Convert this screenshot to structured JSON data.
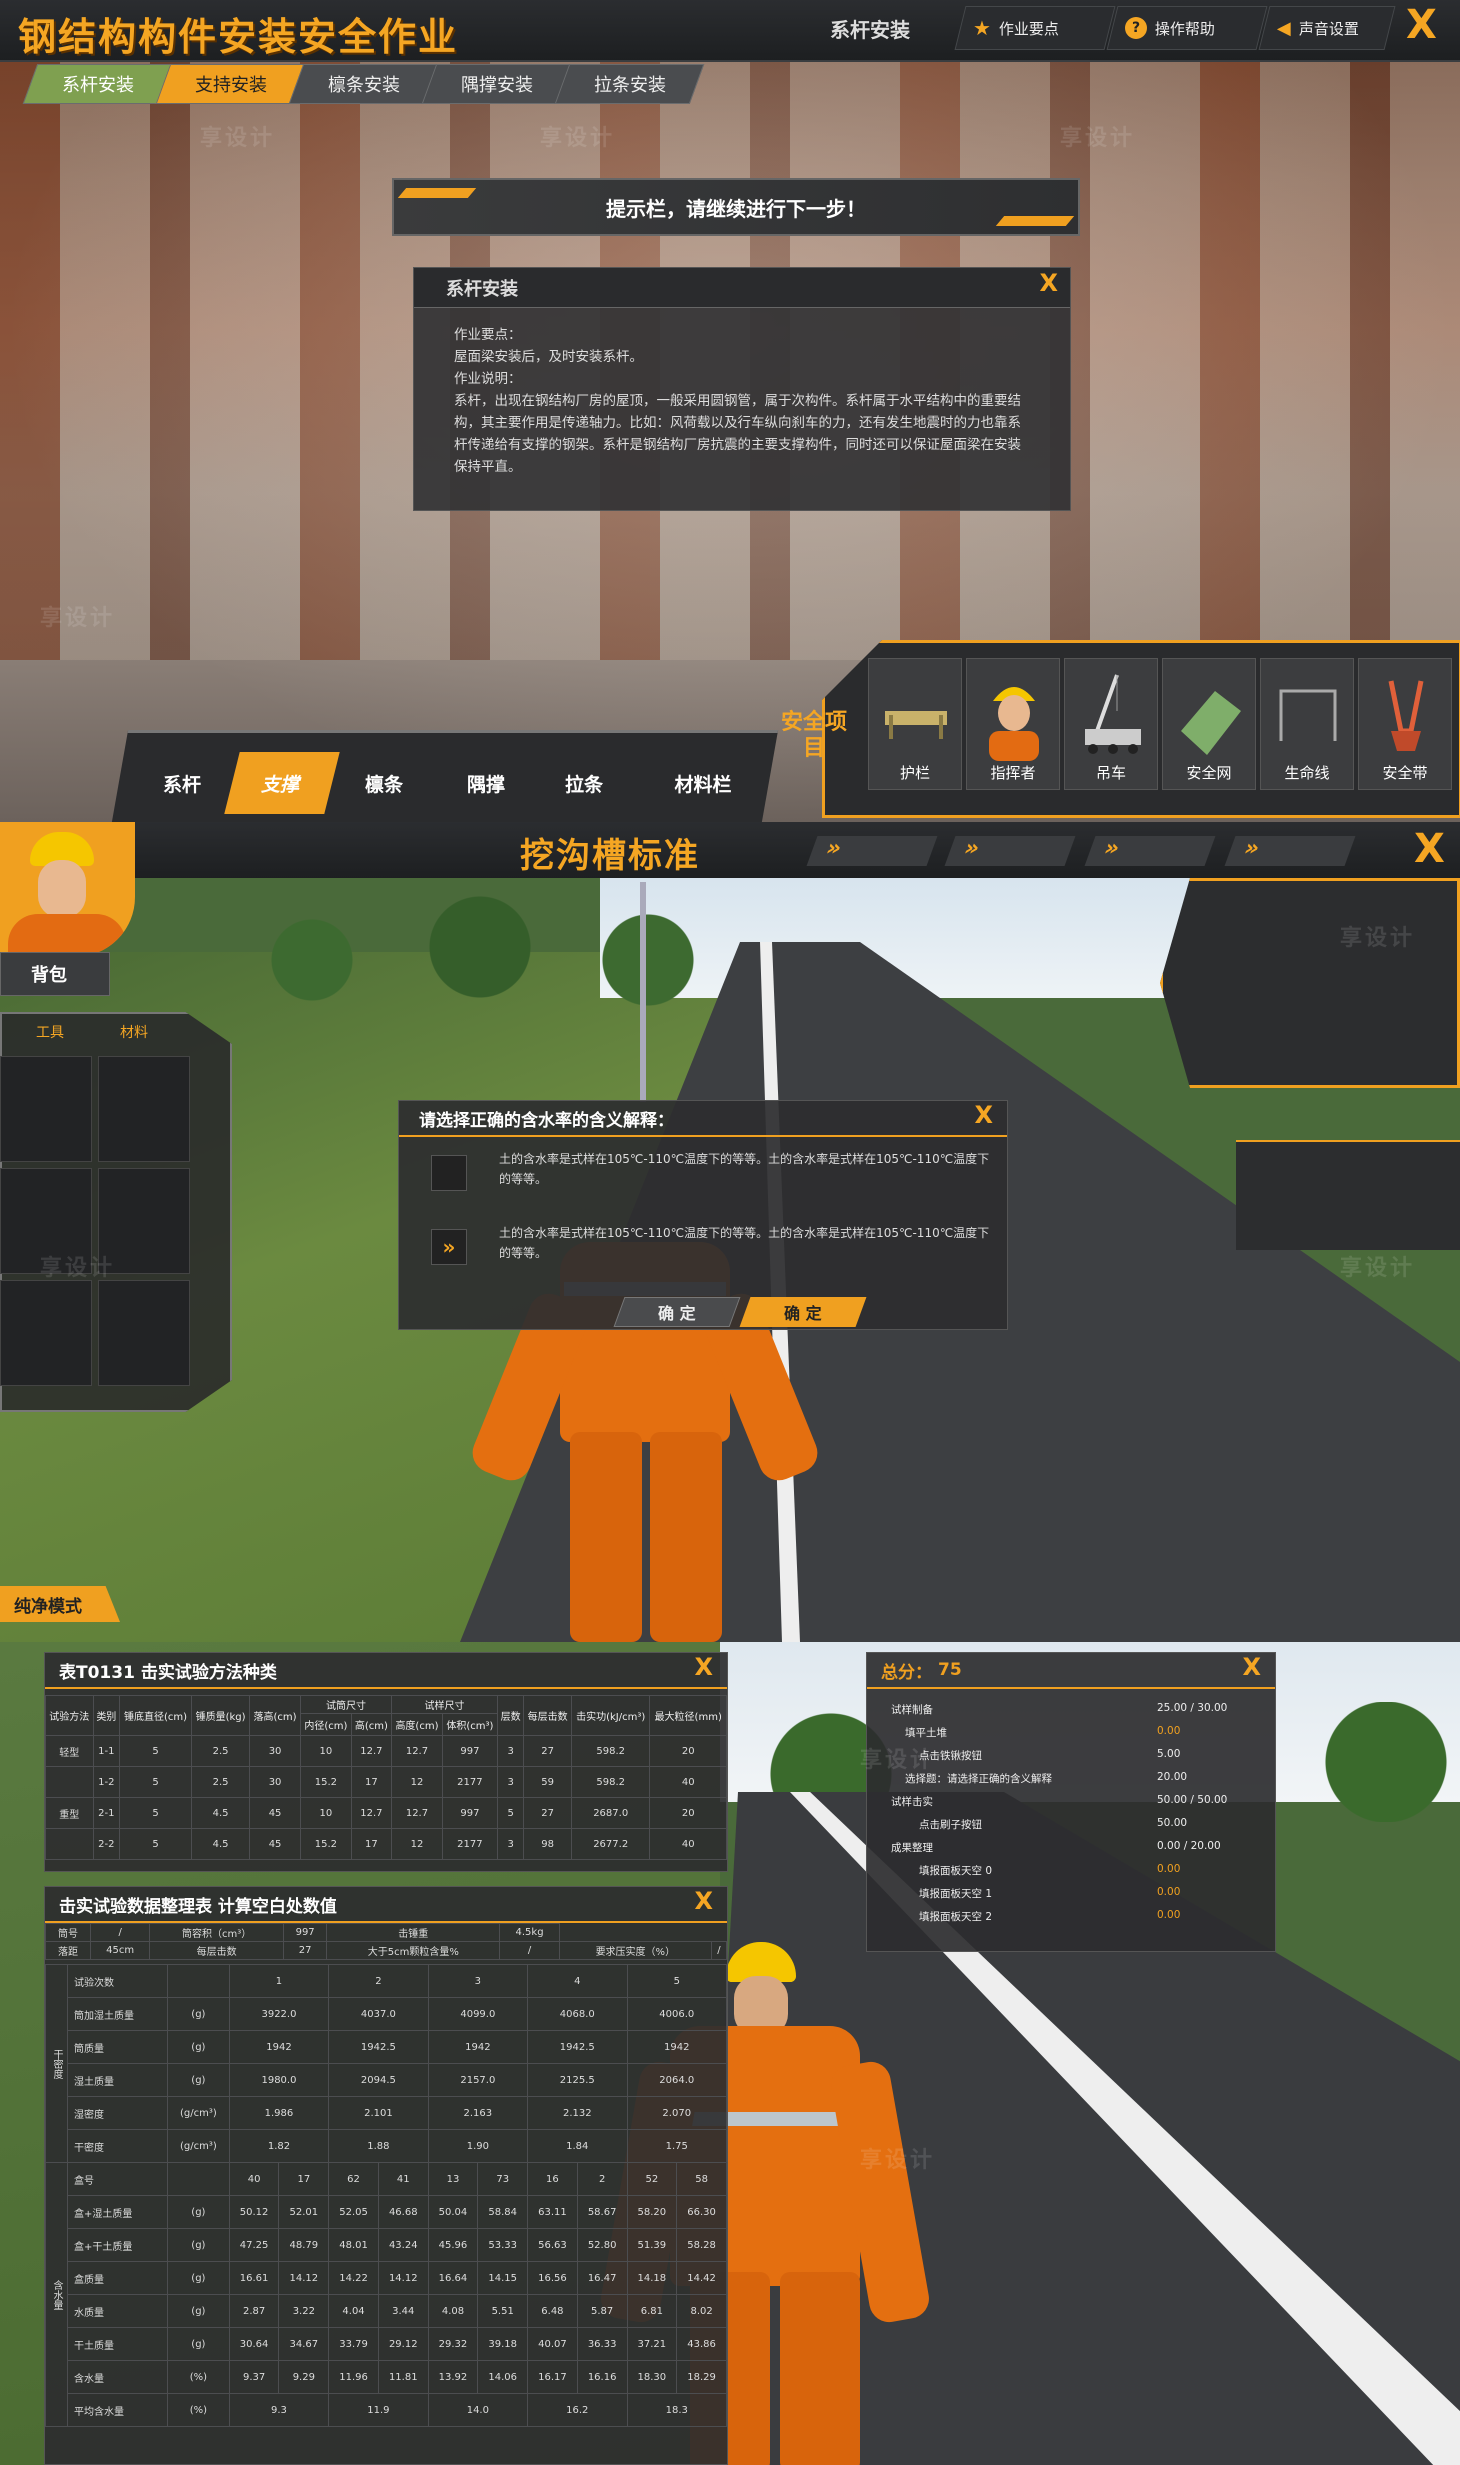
{
  "s1": {
    "app_title": "钢结构构件安装安全作业",
    "step_title": "系杆安装",
    "top_buttons": [
      {
        "icon": "star-icon",
        "label": "作业要点"
      },
      {
        "icon": "help-icon",
        "label": "操作帮助"
      },
      {
        "icon": "speaker-icon",
        "label": "声音设置"
      }
    ],
    "close": "X",
    "tabs": [
      "系杆安装",
      "支持安装",
      "檩条安装",
      "隅撑安装",
      "拉条安装"
    ],
    "prompt": "提示栏，请继续进行下一步！",
    "info": {
      "title": "系杆安装",
      "close": "X",
      "lines": [
        "作业要点：",
        "屋面梁安装后，及时安装系杆。",
        "作业说明：",
        "系杆，出现在钢结构厂房的屋顶，一般采用圆钢管，属于次构件。系杆属于水平结构中的重要结构，其主要作用是传递轴力。比如：风荷载以及行车纵向刹车的力，还有发生地震时的力也靠系杆传递给有支撑的钢架。系杆是钢结构厂房抗震的主要支撑构件，同时还可以保证屋面梁在安装保持平直。"
      ]
    },
    "safety_label": "安全项目",
    "safety_items": [
      "护栏",
      "指挥者",
      "吊车",
      "安全网",
      "生命线",
      "安全带"
    ],
    "materials": [
      "系杆",
      "支撑",
      "檩条",
      "隅撑",
      "拉条",
      "材料栏"
    ],
    "colors": {
      "accent": "#f0a020",
      "tab_green": "#7fa050"
    }
  },
  "s2": {
    "title": "挖沟槽标准",
    "arrows": [
      "»",
      "»",
      "»",
      "»"
    ],
    "close": "X",
    "bag": {
      "title": "背包",
      "tabs": [
        "工具",
        "材料"
      ]
    },
    "pure_mode": "纯净模式",
    "quiz": {
      "title": "请选择正确的含水率的含义解释：",
      "close": "X",
      "options": [
        {
          "mark": "",
          "text": "土的含水率是式样在105℃-110℃温度下的等等。土的含水率是式样在105℃-110℃温度下的等等。"
        },
        {
          "mark": "»",
          "text": "土的含水率是式样在105℃-110℃温度下的等等。土的含水率是式样在105℃-110℃温度下的等等。"
        }
      ],
      "buttons": [
        "确  定",
        "确  定"
      ]
    }
  },
  "s3": {
    "t1": {
      "title": "表T0131 击实试验方法种类",
      "close": "X",
      "h1": [
        "试验方法",
        "类别",
        "锤底直径(cm)",
        "锤质量(kg)",
        "落高(cm)",
        "试筒尺寸",
        "",
        "试样尺寸",
        "",
        "层数",
        "每层击数",
        "击实功(kJ/cm³)",
        "最大粒径(mm)"
      ],
      "h2": [
        "内径(cm)",
        "高(cm)",
        "高度(cm)",
        "体积(cm³)"
      ],
      "rows": [
        [
          "轻型",
          "1-1",
          "5",
          "2.5",
          "30",
          "10",
          "12.7",
          "12.7",
          "997",
          "3",
          "27",
          "598.2",
          "20"
        ],
        [
          "",
          "1-2",
          "5",
          "2.5",
          "30",
          "15.2",
          "17",
          "12",
          "2177",
          "3",
          "59",
          "598.2",
          "40"
        ],
        [
          "重型",
          "2-1",
          "5",
          "4.5",
          "45",
          "10",
          "12.7",
          "12.7",
          "997",
          "5",
          "27",
          "2687.0",
          "20"
        ],
        [
          "",
          "2-2",
          "5",
          "4.5",
          "45",
          "15.2",
          "17",
          "12",
          "2177",
          "3",
          "98",
          "2677.2",
          "40"
        ]
      ]
    },
    "t2": {
      "title": "击实试验数据整理表  计算空白处数值",
      "close": "X",
      "meta1": [
        "筒号",
        "/",
        "筒容积（cm³）",
        "997",
        "击锤重",
        "4.5kg"
      ],
      "meta2": [
        "落距",
        "45cm",
        "每层击数",
        "27",
        "大于5cm颗粒含量%",
        "/",
        "要求压实度（%）",
        "/"
      ],
      "group1": "干密度",
      "group2": "含水量",
      "rows": [
        [
          "试验次数",
          "",
          "1",
          "",
          "2",
          "",
          "3",
          "",
          "4",
          "",
          "5",
          ""
        ],
        [
          "筒加湿土质量",
          "(g)",
          "3922.0",
          "",
          "4037.0",
          "",
          "4099.0",
          "",
          "4068.0",
          "",
          "4006.0",
          ""
        ],
        [
          "筒质量",
          "(g)",
          "1942",
          "",
          "1942.5",
          "",
          "1942",
          "",
          "1942.5",
          "",
          "1942",
          ""
        ],
        [
          "湿土质量",
          "(g)",
          "1980.0",
          "",
          "2094.5",
          "",
          "2157.0",
          "",
          "2125.5",
          "",
          "2064.0",
          ""
        ],
        [
          "湿密度",
          "(g/cm³)",
          "1.986",
          "",
          "2.101",
          "",
          "2.163",
          "",
          "2.132",
          "",
          "2.070",
          ""
        ],
        [
          "干密度",
          "(g/cm³)",
          "1.82",
          "",
          "1.88",
          "",
          "1.90",
          "",
          "1.84",
          "",
          "1.75",
          ""
        ],
        [
          "盒号",
          "",
          "40",
          "17",
          "62",
          "41",
          "13",
          "73",
          "16",
          "2",
          "52",
          "58"
        ],
        [
          "盒+湿土质量",
          "(g)",
          "50.12",
          "52.01",
          "52.05",
          "46.68",
          "50.04",
          "58.84",
          "63.11",
          "58.67",
          "58.20",
          "66.30"
        ],
        [
          "盒+干土质量",
          "(g)",
          "47.25",
          "48.79",
          "48.01",
          "43.24",
          "45.96",
          "53.33",
          "56.63",
          "52.80",
          "51.39",
          "58.28"
        ],
        [
          "盒质量",
          "(g)",
          "16.61",
          "14.12",
          "14.22",
          "14.12",
          "16.64",
          "14.15",
          "16.56",
          "16.47",
          "14.18",
          "14.42"
        ],
        [
          "水质量",
          "(g)",
          "2.87",
          "3.22",
          "4.04",
          "3.44",
          "4.08",
          "5.51",
          "6.48",
          "5.87",
          "6.81",
          "8.02"
        ],
        [
          "干土质量",
          "(g)",
          "30.64",
          "34.67",
          "33.79",
          "29.12",
          "29.32",
          "39.18",
          "40.07",
          "36.33",
          "37.21",
          "43.86"
        ],
        [
          "含水量",
          "(%)",
          "9.37",
          "9.29",
          "11.96",
          "11.81",
          "13.92",
          "14.06",
          "16.17",
          "16.16",
          "18.30",
          "18.29"
        ],
        [
          "平均含水量",
          "(%)",
          "9.3",
          "",
          "11.9",
          "",
          "14.0",
          "",
          "16.2",
          "",
          "18.3",
          ""
        ]
      ]
    },
    "score": {
      "title": "总分：",
      "value": "75",
      "close": "X",
      "items": [
        {
          "label": "试样制备",
          "value": "25.00 / 30.00",
          "indent": 0,
          "orange": false
        },
        {
          "label": "填平土堆",
          "value": "0.00",
          "indent": 1,
          "orange": true
        },
        {
          "label": "点击铁锹按钮",
          "value": "5.00",
          "indent": 2,
          "orange": false
        },
        {
          "label": "选择题：请选择正确的含义解释",
          "value": "20.00",
          "indent": 1,
          "orange": false
        },
        {
          "label": "试样击实",
          "value": "50.00 / 50.00",
          "indent": 0,
          "orange": false
        },
        {
          "label": "点击刷子按钮",
          "value": "50.00",
          "indent": 2,
          "orange": false
        },
        {
          "label": "成果整理",
          "value": "0.00 / 20.00",
          "indent": 0,
          "orange": false
        },
        {
          "label": "填报面板天空 0",
          "value": "0.00",
          "indent": 2,
          "orange": true
        },
        {
          "label": "填报面板天空 1",
          "value": "0.00",
          "indent": 2,
          "orange": true
        },
        {
          "label": "填报面板天空 2",
          "value": "0.00",
          "indent": 2,
          "orange": true
        }
      ]
    }
  },
  "watermark": "享设计"
}
